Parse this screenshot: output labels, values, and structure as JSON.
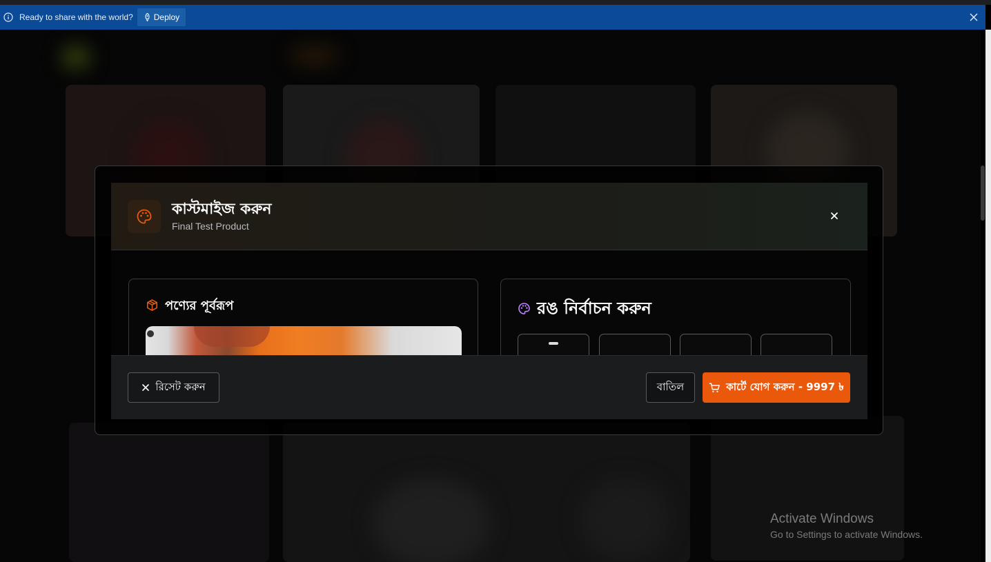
{
  "banner": {
    "message": "Ready to share with the world?",
    "deploy_label": "Deploy",
    "background": "#0b4a96"
  },
  "modal": {
    "title": "কাস্টমাইজ করুন",
    "subtitle": "Final Test Product",
    "accent_color": "#ea580c",
    "icons": {
      "header": "palette-icon",
      "close": "close-icon"
    }
  },
  "preview_panel": {
    "title": "পণ্যের পূর্বরূপ",
    "icon": "box-icon"
  },
  "color_panel": {
    "title": "রঙ নির্বাচন করুন",
    "icon": "palette-icon",
    "icon_color": "#c084fc"
  },
  "footer": {
    "reset_label": "রিসেট করুন",
    "cancel_label": "বাতিল",
    "add_to_cart_label": "কার্টে যোগ করুন - 9997 ৳"
  },
  "watermark": {
    "title": "Activate Windows",
    "subtitle": "Go to Settings to activate Windows."
  }
}
